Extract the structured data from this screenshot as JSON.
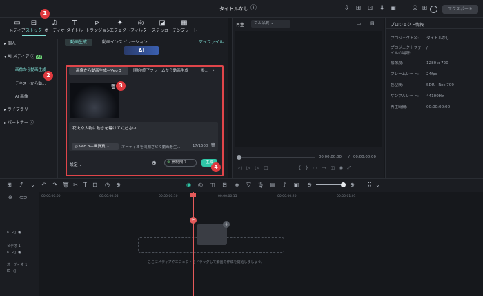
{
  "app_title": "タイトルなし",
  "export_label": "エクスポート",
  "toolbar": [
    {
      "label": "メディア",
      "icon": "media-icon"
    },
    {
      "label": "ストック",
      "icon": "stock-icon"
    },
    {
      "label": "オーディオ",
      "icon": "audio-icon"
    },
    {
      "label": "タイトル",
      "icon": "title-icon"
    },
    {
      "label": "トランジョン",
      "icon": "transition-icon"
    },
    {
      "label": "エフェクト",
      "icon": "effect-icon"
    },
    {
      "label": "フィルター",
      "icon": "filter-icon"
    },
    {
      "label": "ステッカー",
      "icon": "sticker-icon"
    },
    {
      "label": "テンプレート",
      "icon": "template-icon"
    }
  ],
  "sidebar": {
    "personal": "個人",
    "ai_media": "AI メディア",
    "ai_badge": "AI",
    "sub_items": [
      "画像から動画生成",
      "テキストから動...",
      "AI 画像"
    ],
    "library": "ライブラリ",
    "partner": "パートナー"
  },
  "content": {
    "tab_video_gen": "動画生成",
    "tab_inspiration": "動画インスピレーション",
    "my_files": "マイファイル",
    "logo_text": "AI"
  },
  "dialog": {
    "tab1": "画像から動画生成—Veo 3",
    "tab2": "開始/終了フレームから動画生成",
    "tab3": "参...",
    "prompt": "花火や人物に動きを着けてください",
    "model": "Veo 3—画質質",
    "audio_hint": "オーディオを同期させて動画を生...",
    "counter": "17/1500",
    "settings": "設定",
    "free_label": "無制限",
    "generate": "生成"
  },
  "callouts": [
    "1",
    "2",
    "3",
    "4"
  ],
  "preview": {
    "label": "再生",
    "quality": "フル品質",
    "time_current": "00:00:00:00",
    "time_sep": "/",
    "time_total": "00:00:00:00"
  },
  "props": {
    "title": "プロジェクト情報",
    "rows": [
      {
        "k": "プロジェクト名:",
        "v": "タイトルなし"
      },
      {
        "k": "プロジェクトファイルの場所:",
        "v": "/"
      },
      {
        "k": "解像度:",
        "v": "1280 x 720"
      },
      {
        "k": "フレームレート:",
        "v": "24fps"
      },
      {
        "k": "色空間:",
        "v": "SDR - Rec.709"
      },
      {
        "k": "サンプルレート:",
        "v": "44100Hz"
      },
      {
        "k": "再生時間:",
        "v": "00:00:00:00"
      }
    ]
  },
  "timeline": {
    "timecodes": [
      "00:00:00:00",
      "00:00:00:05",
      "00:00:00:10",
      "00:00:00:15",
      "00:00:00:20",
      "00:00:01:01"
    ],
    "video_track": "ビデオ 1",
    "audio_track": "オーディオ 1",
    "drop_hint": "ここにメディアやエフェクトをドラッグして動画の作成を開始しましょう。"
  }
}
